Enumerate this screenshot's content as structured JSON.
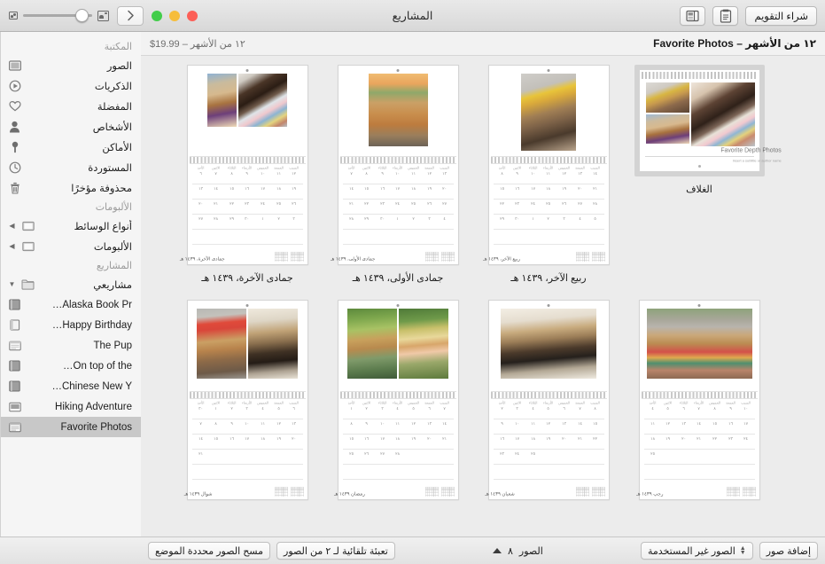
{
  "window": {
    "title": "المشاريع",
    "traffic_lights": [
      "close",
      "minimize",
      "zoom"
    ],
    "colors": {
      "close": "#fc5f57",
      "minimize": "#f6bd3b",
      "zoom": "#42cd4a"
    }
  },
  "toolbar": {
    "buy_calendar_label": "شراء التقويم",
    "notes_icon": "clipboard-icon",
    "layout_icon": "layout-panel-icon",
    "zoom_small_icon": "thumbnail-small-icon",
    "zoom_large_icon": "thumbnail-large-icon",
    "sidebar_toggle_icon": "chevron-right-icon"
  },
  "project_header": {
    "title": "١٢ من الأشهر – Favorite Photos",
    "price": "١٢ من الأشهر – 19.99$"
  },
  "sidebar": {
    "sections": [
      {
        "header": "المكتبة",
        "items": [
          {
            "label": "الصور",
            "icon": "photos-icon"
          },
          {
            "label": "الذكريات",
            "icon": "memories-icon"
          },
          {
            "label": "المفضلة",
            "icon": "heart-icon"
          },
          {
            "label": "الأشخاص",
            "icon": "person-icon"
          },
          {
            "label": "الأماكن",
            "icon": "pin-icon"
          },
          {
            "label": "المستوردة",
            "icon": "clock-icon"
          },
          {
            "label": "محذوفة مؤخرًا",
            "icon": "trash-icon"
          }
        ]
      },
      {
        "header": "الألبومات",
        "items": [
          {
            "label": "أنواع الوسائط",
            "icon": "folder-icon",
            "disclosure": "collapsed"
          },
          {
            "label": "الألبومات",
            "icon": "folder-icon",
            "disclosure": "collapsed"
          }
        ]
      },
      {
        "header": "المشاريع",
        "items": [
          {
            "label": "مشاريعي",
            "icon": "folder-icon",
            "disclosure": "expanded"
          }
        ],
        "children": [
          {
            "label": "Alaska Book Pr…",
            "icon": "book-icon",
            "selected": false
          },
          {
            "label": "Happy Birthday…",
            "icon": "card-icon",
            "selected": false
          },
          {
            "label": "The Pup",
            "icon": "calendar-icon",
            "selected": false
          },
          {
            "label": "On top of the…",
            "icon": "book-icon",
            "selected": false
          },
          {
            "label": "Chinese New Y…",
            "icon": "book-icon",
            "selected": false
          },
          {
            "label": "Hiking Adventure",
            "icon": "print-icon",
            "selected": false
          },
          {
            "label": "Favorite Photos",
            "icon": "calendar-icon",
            "selected": true
          }
        ]
      }
    ]
  },
  "canvas": {
    "row1": [
      {
        "kind": "cover",
        "caption": "الغلاف",
        "selected": true,
        "cover_title": "Favorite Depth Photos",
        "cover_subtitle": "Insert a subtitle or author name"
      },
      {
        "kind": "month",
        "caption": "ربيع الآخر، ١٤٣٩ هـ",
        "month_label": "ربيع الآخر، ١٤٣٩ هـ",
        "selected": false,
        "dows": [
          "السبت",
          "الجمعة",
          "الخميس",
          "الأربعاء",
          "الثلاثاء",
          "الاثنين",
          "الأحد"
        ],
        "weeks": [
          [
            "١٤",
            "١٣",
            "١٢",
            "١١",
            "١٠",
            "٩",
            "٨"
          ],
          [
            "٢١",
            "٢٠",
            "١٩",
            "١٨",
            "١٧",
            "١٦",
            "١٥"
          ],
          [
            "٢٨",
            "٢٧",
            "٢٦",
            "٢٥",
            "٢٤",
            "٢٣",
            "٢٢"
          ],
          [
            "٥",
            "٤",
            "٣",
            "٢",
            "١",
            "٣٠",
            "٢٩"
          ],
          [
            "",
            "",
            "",
            "",
            "",
            "",
            ""
          ]
        ]
      },
      {
        "kind": "month",
        "caption": "جمادى الأولى، ١٤٣٩ هـ",
        "month_label": "جمادى الأولى، ١٤٣٩ هـ",
        "selected": false,
        "dows": [
          "السبت",
          "الجمعة",
          "الخميس",
          "الأربعاء",
          "الثلاثاء",
          "الاثنين",
          "الأحد"
        ],
        "weeks": [
          [
            "١٣",
            "١٢",
            "١١",
            "١٠",
            "٩",
            "٨",
            "٧"
          ],
          [
            "٢٠",
            "١٩",
            "١٨",
            "١٧",
            "١٦",
            "١٥",
            "١٤"
          ],
          [
            "٢٧",
            "٢٦",
            "٢٥",
            "٢٤",
            "٢٣",
            "٢٢",
            "٢١"
          ],
          [
            "٤",
            "٣",
            "٢",
            "١",
            "٣٠",
            "٢٩",
            "٢٨"
          ],
          [
            "",
            "",
            "",
            "",
            "",
            "",
            ""
          ]
        ]
      },
      {
        "kind": "month",
        "caption": "جمادى الآخرة، ١٤٣٩ هـ",
        "month_label": "جمادى الآخرة، ١٤٣٩ هـ",
        "selected": false,
        "dows": [
          "السبت",
          "الجمعة",
          "الخميس",
          "الأربعاء",
          "الثلاثاء",
          "الاثنين",
          "الأحد"
        ],
        "weeks": [
          [
            "١٢",
            "١١",
            "١٠",
            "٩",
            "٨",
            "٧",
            "٦"
          ],
          [
            "١٩",
            "١٨",
            "١٧",
            "١٦",
            "١٥",
            "١٤",
            "١٣"
          ],
          [
            "٢٦",
            "٢٥",
            "٢٤",
            "٢٣",
            "٢٢",
            "٢١",
            "٢٠"
          ],
          [
            "٣",
            "٢",
            "١",
            "٣٠",
            "٢٩",
            "٢٨",
            "٢٧"
          ],
          [
            "",
            "",
            "",
            "",
            "",
            "",
            ""
          ]
        ]
      }
    ],
    "row2": [
      {
        "kind": "month",
        "caption": "",
        "month_label": "رجب ١٤٣٩ هـ",
        "selected": false,
        "dows": [
          "السبت",
          "الجمعة",
          "الخميس",
          "الأربعاء",
          "الثلاثاء",
          "الاثنين",
          "الأحد"
        ],
        "weeks": [
          [
            "١٠",
            "٩",
            "٨",
            "٧",
            "٦",
            "٥",
            "٤"
          ],
          [
            "١٧",
            "١٦",
            "١٥",
            "١٤",
            "١٣",
            "١٢",
            "١١"
          ],
          [
            "٢٤",
            "٢٣",
            "٢٢",
            "٢١",
            "٢٠",
            "١٩",
            "١٨"
          ],
          [
            "",
            "",
            "",
            "",
            "",
            "",
            "٢٥"
          ],
          [
            "",
            "",
            "",
            "",
            "",
            "",
            ""
          ]
        ]
      },
      {
        "kind": "month",
        "caption": "",
        "month_label": "شعبان ١٤٣٩ هـ",
        "selected": false,
        "dows": [
          "السبت",
          "الجمعة",
          "الخميس",
          "الأربعاء",
          "الثلاثاء",
          "الاثنين",
          "الأحد"
        ],
        "weeks": [
          [
            "٨",
            "٧",
            "٦",
            "٥",
            "٤",
            "٣",
            "٢"
          ],
          [
            "١٥",
            "١٤",
            "١٣",
            "١٢",
            "١١",
            "١٠",
            "٩"
          ],
          [
            "٢٢",
            "٢١",
            "٢٠",
            "١٩",
            "١٨",
            "١٧",
            "١٦"
          ],
          [
            "",
            "",
            "",
            "",
            "٢٥",
            "٢٤",
            "٢٣"
          ],
          [
            "",
            "",
            "",
            "",
            "",
            "",
            ""
          ]
        ]
      },
      {
        "kind": "month",
        "caption": "",
        "month_label": "رمضان ١٤٣٩ هـ",
        "selected": false,
        "dows": [
          "السبت",
          "الجمعة",
          "الخميس",
          "الأربعاء",
          "الثلاثاء",
          "الاثنين",
          "الأحد"
        ],
        "weeks": [
          [
            "٧",
            "٦",
            "٥",
            "٤",
            "٣",
            "٢",
            "١"
          ],
          [
            "١٤",
            "١٣",
            "١٢",
            "١١",
            "١٠",
            "٩",
            "٨"
          ],
          [
            "٢١",
            "٢٠",
            "١٩",
            "١٨",
            "١٧",
            "١٦",
            "١٥"
          ],
          [
            "",
            "",
            "",
            "٢٨",
            "٢٧",
            "٢٦",
            "٢٥"
          ],
          [
            "",
            "",
            "",
            "",
            "",
            "",
            ""
          ]
        ]
      },
      {
        "kind": "month",
        "caption": "",
        "month_label": "شوال ١٤٣٩ هـ",
        "selected": false,
        "dows": [
          "السبت",
          "الجمعة",
          "الخميس",
          "الأربعاء",
          "الثلاثاء",
          "الاثنين",
          "الأحد"
        ],
        "weeks": [
          [
            "٦",
            "٥",
            "٤",
            "٣",
            "٢",
            "١",
            "٣٠"
          ],
          [
            "١٣",
            "١٢",
            "١١",
            "١٠",
            "٩",
            "٨",
            "٧"
          ],
          [
            "٢٠",
            "١٩",
            "١٨",
            "١٧",
            "١٦",
            "١٥",
            "١٤"
          ],
          [
            "",
            "",
            "",
            "",
            "",
            "",
            "٢١"
          ],
          [
            "",
            "",
            "",
            "",
            "",
            "",
            ""
          ]
        ]
      }
    ]
  },
  "bottombar": {
    "add_photos_label": "إضافة صور",
    "unused_photos_label": "الصور غير المستخدمة",
    "photos_label": "الصور",
    "photos_count": "٨",
    "autofill_label": "تعبئة تلقائية لـ ٢ من الصور",
    "clear_placed_label": "مسح الصور محددة الموضع"
  }
}
